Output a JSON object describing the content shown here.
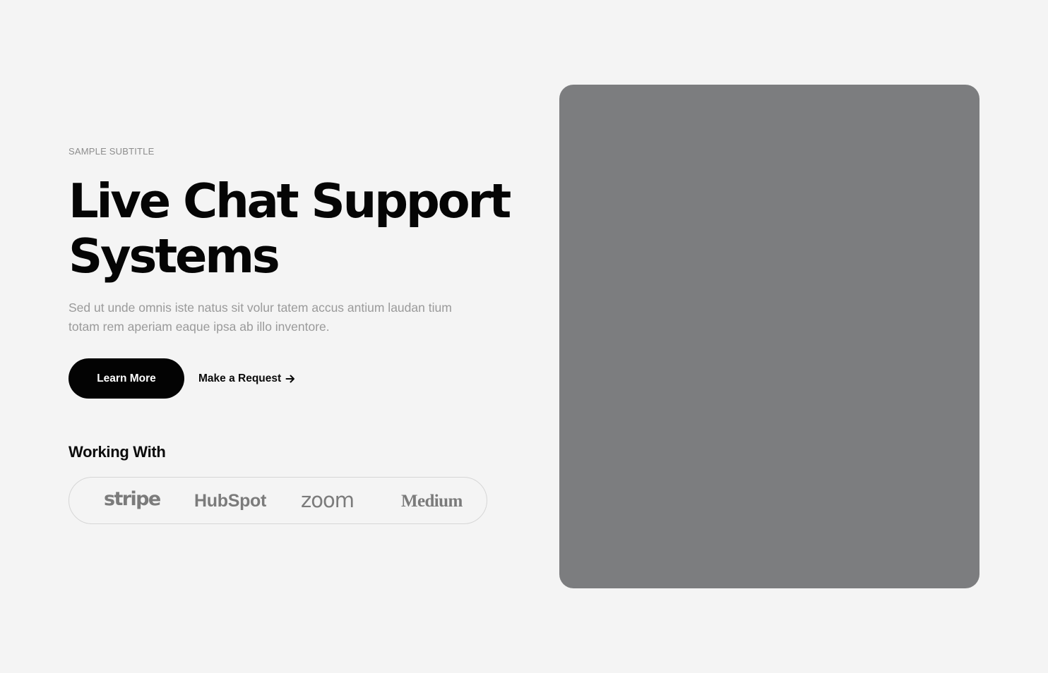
{
  "hero": {
    "subtitle": "SAMPLE SUBTITLE",
    "title_line1": "Live Chat Support",
    "title_line2": "Systems",
    "description": "Sed ut unde omnis iste natus sit volur tatem accus antium laudan tium totam rem aperiam eaque ipsa ab illo inventore.",
    "primary_button": "Learn More",
    "secondary_link": "Make a Request",
    "secondary_icon": "arrow-right-icon"
  },
  "partners": {
    "heading": "Working With",
    "logos": [
      "stripe",
      "HubSpot",
      "zoom",
      "Medium"
    ]
  },
  "colors": {
    "background": "#f4f4f4",
    "primary_button": "#030303",
    "media_placeholder": "#7c7d7f",
    "muted_text": "#9a9a9a"
  }
}
